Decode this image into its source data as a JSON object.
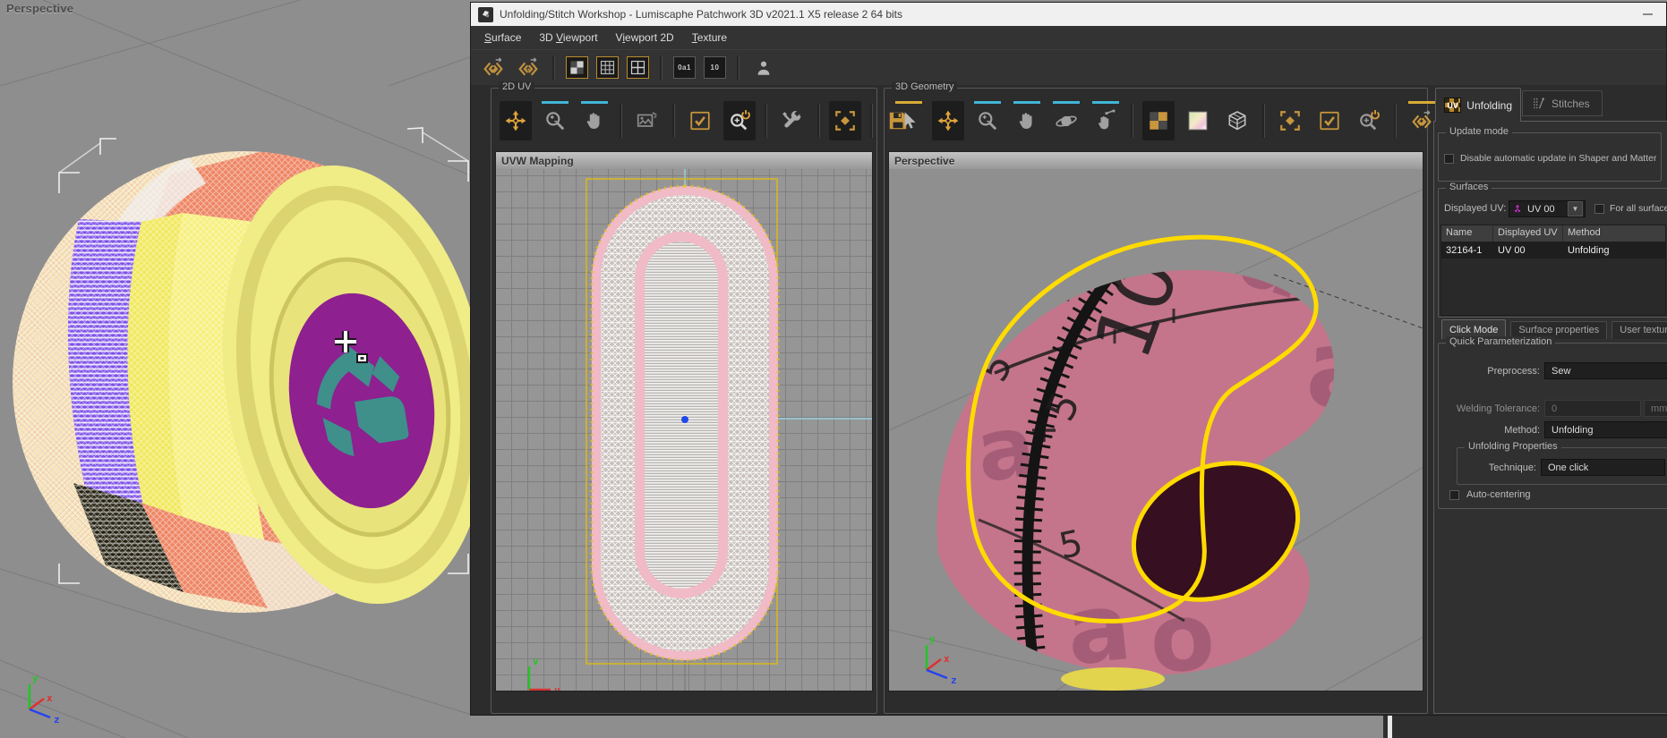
{
  "window": {
    "title": "Unfolding/Stitch Workshop - Lumiscaphe Patchwork 3D v2021.1 X5 release 2 64 bits"
  },
  "menu": {
    "items": [
      {
        "pre": "",
        "key": "S",
        "rest": "urface"
      },
      {
        "pre": "3D ",
        "key": "V",
        "rest": "iewport"
      },
      {
        "pre": "V",
        "key": "i",
        "rest": "ewport 2D"
      },
      {
        "pre": "",
        "key": "T",
        "rest": "exture"
      }
    ]
  },
  "bg_viewport": {
    "label": "Perspective",
    "axis": {
      "x": "x",
      "y": "y",
      "z": "z"
    }
  },
  "uv_panel": {
    "title": "2D UV",
    "viewport_label": "UVW Mapping",
    "axis_u": "u",
    "axis_v": "v"
  },
  "geo_panel": {
    "title": "3D Geometry",
    "viewport_label": "Perspective",
    "axis": {
      "x": "x",
      "y": "y",
      "z": "z"
    },
    "tape_numbers": [
      "15",
      "10",
      "10",
      "5",
      "5",
      "5",
      "5"
    ],
    "tape_letters": [
      "a",
      "o"
    ]
  },
  "icons": {
    "uv_tab": "UV",
    "uv_ids": "0a1",
    "uv_scale": "10",
    "dd_arrow": "▼"
  },
  "right_panel": {
    "tabs": [
      {
        "label": "Unfolding"
      },
      {
        "label": "Stitches"
      }
    ],
    "update_mode": {
      "title": "Update mode",
      "disable_label": "Disable automatic update in Shaper and Matter"
    },
    "surfaces": {
      "title": "Surfaces",
      "displayed_uv_label": "Displayed UV:",
      "displayed_uv_value": "UV 00",
      "for_all_label": "For all surfaces",
      "table": {
        "columns": [
          "Name",
          "Displayed UV",
          "Method"
        ],
        "rows": [
          {
            "name": "32164-1",
            "uv": "UV 00",
            "method": "Unfolding"
          }
        ]
      },
      "mode_tabs": [
        {
          "label": "Click Mode"
        },
        {
          "label": "Surface properties"
        },
        {
          "label": "User texture"
        }
      ]
    },
    "quick": {
      "title": "Quick Parameterization",
      "preprocess_label": "Preprocess:",
      "preprocess_value": "Sew",
      "welding_label": "Welding Tolerance:",
      "welding_value": "0",
      "welding_unit": "mm",
      "method_label": "Method:",
      "method_value": "Unfolding",
      "props_title": "Unfolding Properties",
      "technique_label": "Technique:",
      "technique_value": "One click",
      "auto_center_label": "Auto-centering"
    }
  },
  "colors": {
    "accent_orange": "#d79b3a",
    "tool_cyan": "#41b5d6",
    "uv_outline_yellow": "#ffdb00",
    "uv_island_pink": "#f0bac6",
    "cuff_pink": "#c4758b",
    "logo_purple": "#8e2090",
    "logo_teal": "#3f8f8b"
  }
}
